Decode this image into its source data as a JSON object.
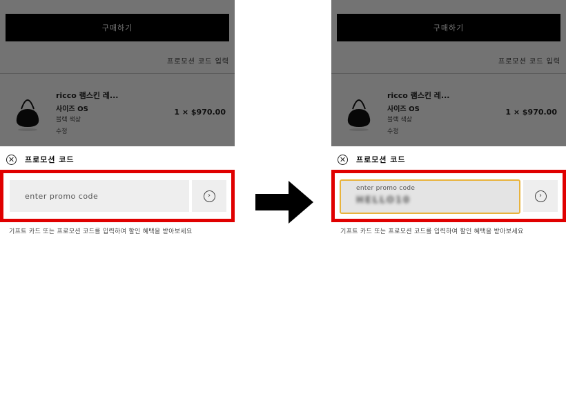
{
  "checkout": {
    "buy_button": "구매하기",
    "promo_link": "프로모션 코드 입력"
  },
  "product": {
    "name": "ricco 램스킨 레...",
    "size": "사이즈 OS",
    "color": "블랙 색상",
    "qty_label": "수정",
    "price": "1 × $970.00"
  },
  "promo": {
    "close_icon": "x-icon",
    "title": "프로모션 코드",
    "placeholder": "enter promo code",
    "float_label": "enter promo code",
    "entered_value": "HELLO10",
    "submit_icon": "chevron-right-icon",
    "hint": "기프트 카드 또는 프로모션 코드를 입력하여 할인 혜택을 받아보세요"
  },
  "colors": {
    "highlight": "#e00000",
    "focus_border": "#e8b33d",
    "button_bg": "#000000"
  }
}
